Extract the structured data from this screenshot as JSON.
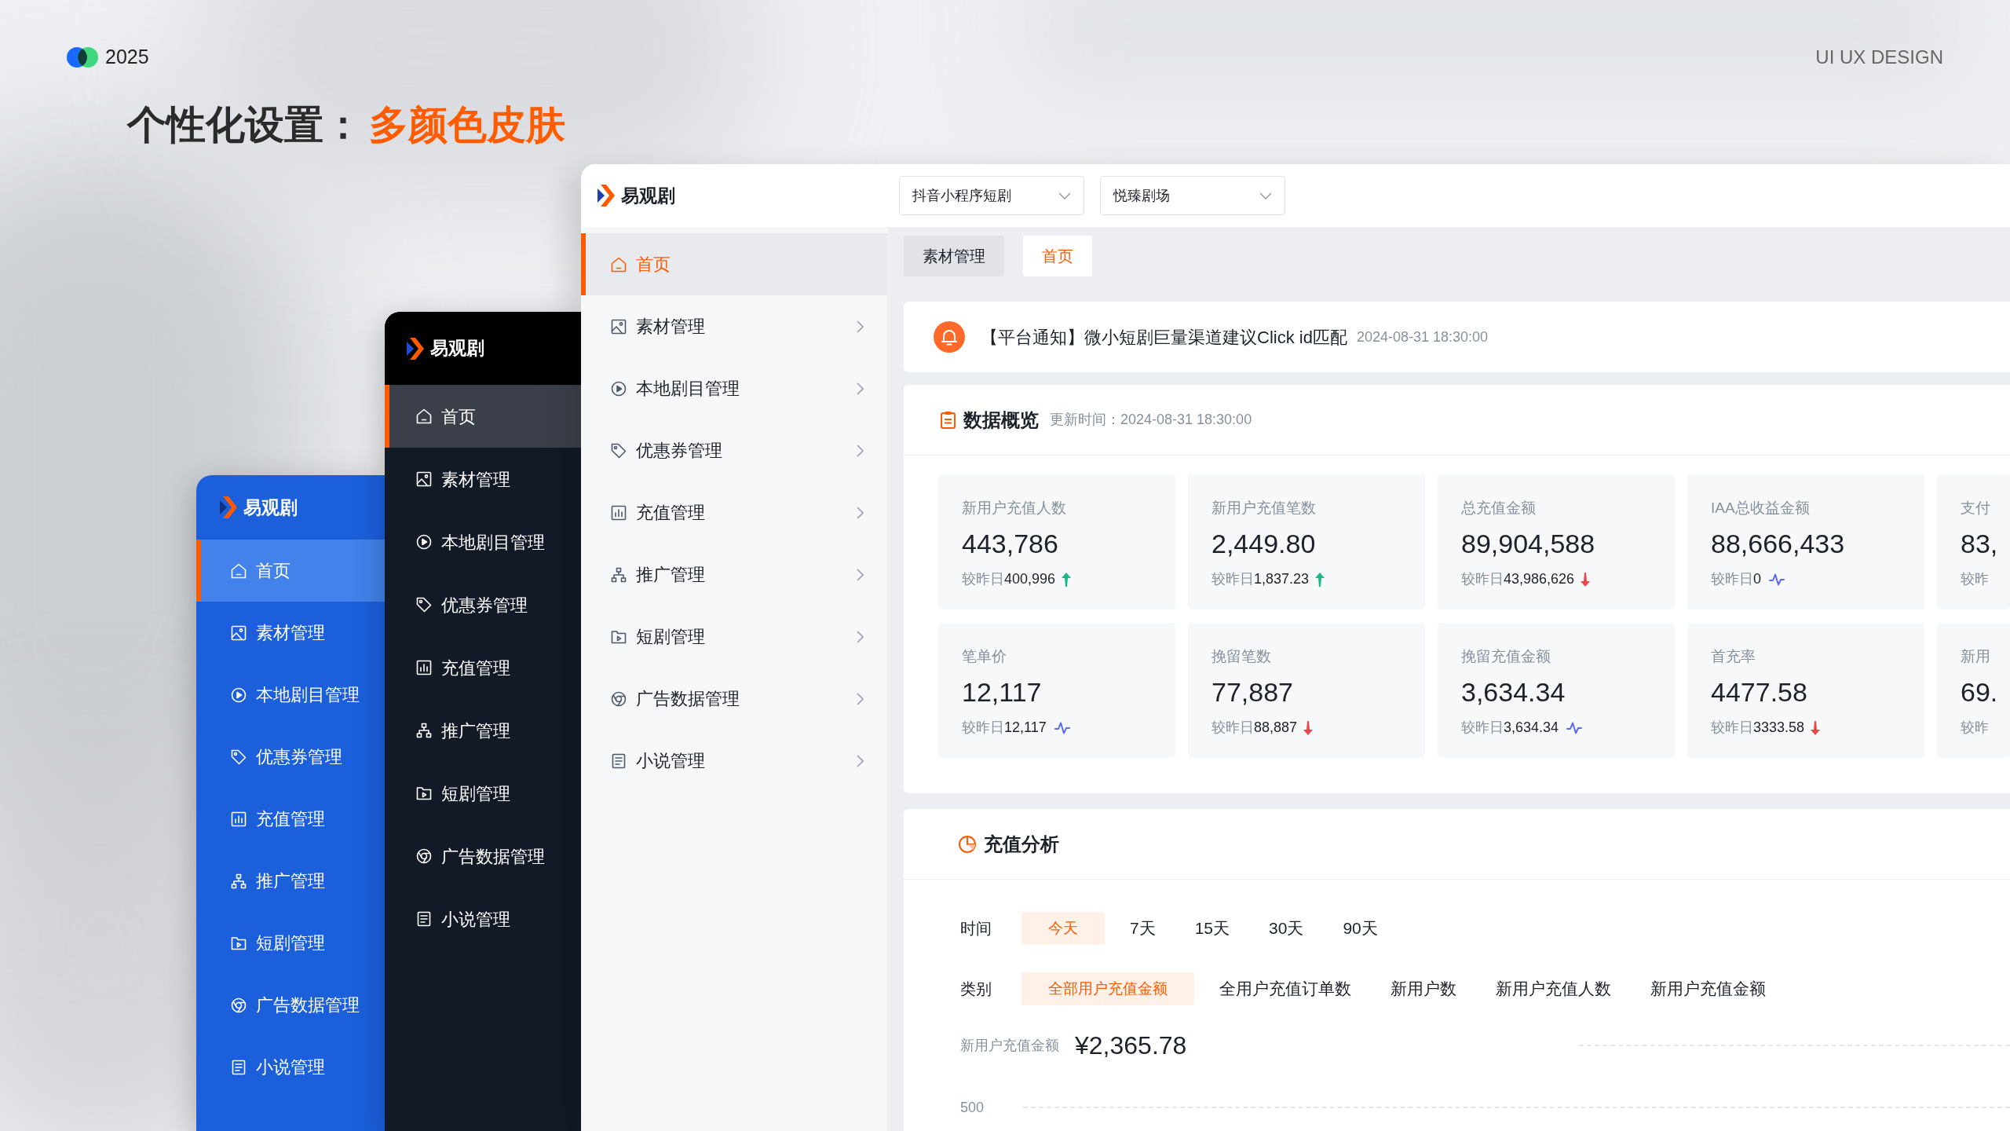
{
  "header": {
    "year": "2025",
    "tagline": "UI UX DESIGN"
  },
  "title": {
    "text": "个性化设置：",
    "highlight": "多颜色皮肤"
  },
  "skins": [
    {
      "kind": "blue",
      "logo_text": "易观剧",
      "menu": [
        {
          "label": "首页",
          "selected": true
        },
        {
          "label": "素材管理",
          "selected": false
        },
        {
          "label": "本地剧目管理",
          "selected": false
        },
        {
          "label": "优惠券管理",
          "selected": false
        },
        {
          "label": "充值管理",
          "selected": false
        },
        {
          "label": "推广管理",
          "selected": false
        },
        {
          "label": "短剧管理",
          "selected": false
        },
        {
          "label": "广告数据管理",
          "selected": false
        },
        {
          "label": "小说管理",
          "selected": false
        }
      ]
    },
    {
      "kind": "dark",
      "logo_text": "易观剧",
      "menu": [
        {
          "label": "首页",
          "selected": true
        },
        {
          "label": "素材管理",
          "selected": false
        },
        {
          "label": "本地剧目管理",
          "selected": false
        },
        {
          "label": "优惠券管理",
          "selected": false
        },
        {
          "label": "充值管理",
          "selected": false
        },
        {
          "label": "推广管理",
          "selected": false
        },
        {
          "label": "短剧管理",
          "selected": false
        },
        {
          "label": "广告数据管理",
          "selected": false
        },
        {
          "label": "小说管理",
          "selected": false
        }
      ]
    }
  ],
  "main_window": {
    "logo_text": "易观剧",
    "selects": [
      {
        "value": "抖音小程序短剧"
      },
      {
        "value": "悦臻剧场"
      }
    ],
    "menu": [
      {
        "label": "首页",
        "kind": "page",
        "selected": true
      },
      {
        "label": "素材管理",
        "kind": "group",
        "selected": false
      },
      {
        "label": "本地剧目管理",
        "kind": "group",
        "selected": false
      },
      {
        "label": "优惠券管理",
        "kind": "group",
        "selected": false
      },
      {
        "label": "充值管理",
        "kind": "group",
        "selected": false
      },
      {
        "label": "推广管理",
        "kind": "group",
        "selected": false
      },
      {
        "label": "短剧管理",
        "kind": "group",
        "selected": false
      },
      {
        "label": "广告数据管理",
        "kind": "group",
        "selected": false
      },
      {
        "label": "小说管理",
        "kind": "group",
        "selected": false
      }
    ],
    "tabs": [
      {
        "label": "素材管理",
        "selected": false
      },
      {
        "label": "首页",
        "selected": true
      }
    ],
    "notice": {
      "text": "【平台通知】微小短剧巨量渠道建议Click id匹配",
      "time": "2024-08-31 18:30:00"
    },
    "overview": {
      "title": "数据概览",
      "updated": "更新时间：2024-08-31 18:30:00",
      "metrics": [
        {
          "kind": "rising",
          "label": "新用户充值人数",
          "value": "443,786",
          "compare_label": "较昨日",
          "compare_value": "400,996"
        },
        {
          "kind": "rising",
          "label": "新用户充值笔数",
          "value": "2,449.80",
          "compare_label": "较昨日",
          "compare_value": "1,837.23"
        },
        {
          "kind": "falling",
          "label": "总充值金额",
          "value": "89,904,588",
          "compare_label": "较昨日",
          "compare_value": "43,986,626"
        },
        {
          "kind": "steady",
          "label": "IAA总收益金额",
          "value": "88,666,433",
          "compare_label": "较昨日",
          "compare_value": "0"
        },
        {
          "kind": "plain",
          "label": "支付",
          "value": "83,",
          "compare_label": "较昨"
        },
        {
          "kind": "steady",
          "label": "笔单价",
          "value": "12,117",
          "compare_label": "较昨日",
          "compare_value": "12,117"
        },
        {
          "kind": "falling",
          "label": "挽留笔数",
          "value": "77,887",
          "compare_label": "较昨日",
          "compare_value": "88,887"
        },
        {
          "kind": "steady",
          "label": "挽留充值金额",
          "value": "3,634.34",
          "compare_label": "较昨日",
          "compare_value": "3,634.34"
        },
        {
          "kind": "falling",
          "label": "首充率",
          "value": "4477.58",
          "compare_label": "较昨日",
          "compare_value": "3333.58"
        },
        {
          "kind": "plain",
          "label": "新用",
          "value": "69.",
          "compare_label": "较昨"
        }
      ]
    },
    "analysis": {
      "title": "充值分析",
      "time_filter": {
        "label": "时间",
        "options": [
          {
            "label": "今天",
            "selected": true
          },
          {
            "label": "7天",
            "selected": false
          },
          {
            "label": "15天",
            "selected": false
          },
          {
            "label": "30天",
            "selected": false
          },
          {
            "label": "90天",
            "selected": false
          }
        ]
      },
      "category_filter": {
        "label": "类别",
        "options": [
          {
            "label": "全部用户充值金额",
            "selected": true
          },
          {
            "label": "全用户充值订单数",
            "selected": false
          },
          {
            "label": "新用户数",
            "selected": false
          },
          {
            "label": "新用户充值人数",
            "selected": false
          },
          {
            "label": "新用户充值金额",
            "selected": false
          }
        ]
      },
      "summary": {
        "label": "新用户充值金额",
        "value": "¥2,365.78"
      },
      "chart": {
        "y_tick": "500"
      }
    }
  }
}
